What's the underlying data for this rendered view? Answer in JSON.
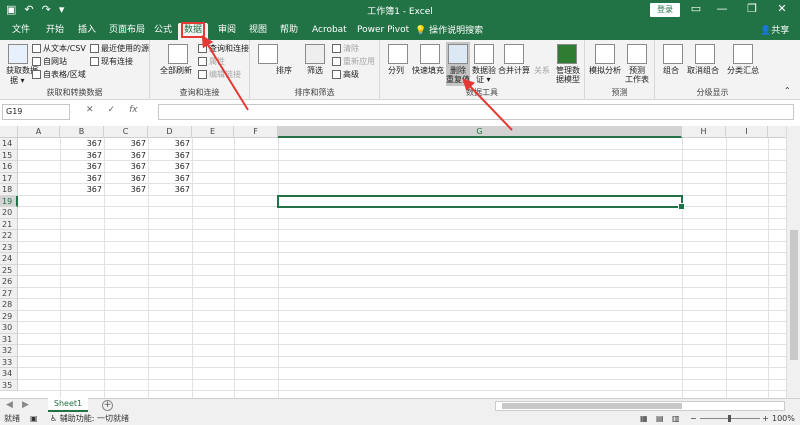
{
  "titlebar": {
    "save_icon": "save-icon",
    "undo_icon": "undo-icon",
    "redo_icon": "redo-icon",
    "title": "工作簿1 - Excel",
    "login": "登录",
    "minimize": "—",
    "restore": "❐",
    "close": "✕"
  },
  "tabs": [
    "文件",
    "开始",
    "插入",
    "页面布局",
    "公式",
    "数据",
    "审阅",
    "视图",
    "帮助",
    "Acrobat",
    "Power Pivot"
  ],
  "active_tab": "数据",
  "tell_me": "操作说明搜索",
  "share": "共享",
  "ribbon": {
    "get_data": "获取数据",
    "get_data_2": "据 ▾",
    "from_csv": "从文本/CSV",
    "from_web": "自网站",
    "from_table": "自表格/区域",
    "recent_sources": "最近使用的源",
    "existing_conn": "现有连接",
    "group_get": "获取和转换数据",
    "refresh_all": "全部刷新",
    "queries_conn": "查询和连接",
    "properties": "属性",
    "edit_links": "编辑链接",
    "group_queries": "查询和连接",
    "sort": "排序",
    "filter": "筛选",
    "clear": "清除",
    "reapply": "重新应用",
    "advanced": "高级",
    "group_sort": "排序和筛选",
    "split": "分列",
    "flash_fill": "快速填充",
    "remove_dup": "删除",
    "remove_dup_2": "重复值",
    "validation": "数据验",
    "validation_2": "证 ▾",
    "consolidate": "合并计算",
    "relationships": "关系",
    "manage_model": "管理数",
    "manage_model_2": "据模型",
    "group_tools": "数据工具",
    "whatif": "模拟分析",
    "forecast_sheet": "预测",
    "forecast_sheet_2": "工作表",
    "group_forecast": "预测",
    "group_btn": "组合",
    "ungroup": "取消组合",
    "subtotal": "分类汇总",
    "group_outline": "分级显示"
  },
  "formula_bar": {
    "name_box": "G19",
    "cancel": "✕",
    "enter": "✓",
    "fx": "fx",
    "value": ""
  },
  "columns": [
    "A",
    "B",
    "C",
    "D",
    "E",
    "F",
    "G",
    "H",
    "I"
  ],
  "selected_column": "G",
  "rows": [
    "14",
    "15",
    "16",
    "17",
    "18",
    "19",
    "20",
    "21",
    "22",
    "23",
    "24",
    "25",
    "26",
    "27",
    "28",
    "29",
    "30",
    "31",
    "32",
    "33",
    "34",
    "35"
  ],
  "selected_row": "19",
  "cells": {
    "r14": [
      "367",
      "367",
      "367"
    ],
    "r15": [
      "367",
      "367",
      "367"
    ],
    "r16": [
      "367",
      "367",
      "367"
    ],
    "r17": [
      "367",
      "367",
      "367"
    ],
    "r18": [
      "367",
      "367",
      "367"
    ]
  },
  "sheet_tab": "Sheet1",
  "add_sheet": "+",
  "status": {
    "ready": "就绪",
    "accessibility": "辅助功能: 一切就绪",
    "zoom": "100%"
  },
  "annotation_color": "#e53935",
  "accent_color": "#217346"
}
